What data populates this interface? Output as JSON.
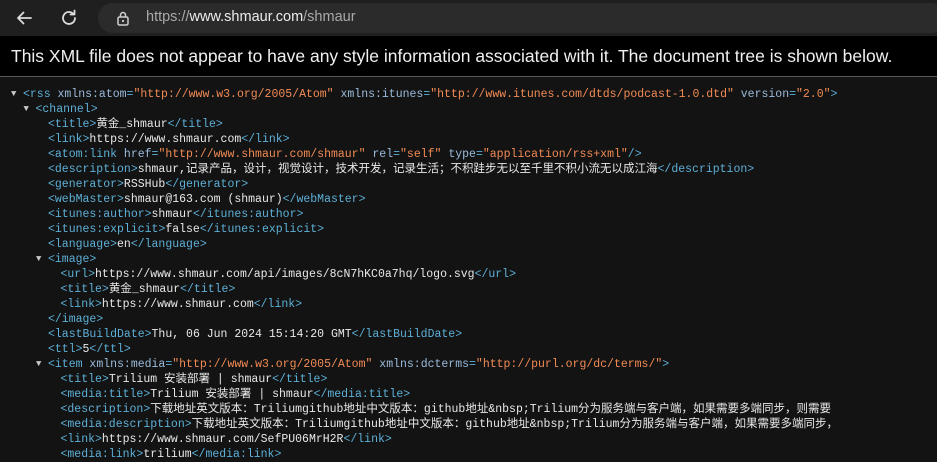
{
  "browser": {
    "url_prefix": "https://",
    "url_domain": "www.shmaur.com",
    "url_path": "/shmaur"
  },
  "notice": "This XML file does not appear to have any style information associated with it. The document tree is shown below.",
  "xml_lines": [
    {
      "indent": 0,
      "arrow": true,
      "tokens": [
        [
          "t",
          "<rss "
        ],
        [
          "an",
          "xmlns:atom"
        ],
        [
          "t",
          "="
        ],
        [
          "av",
          "\"http://www.w3.org/2005/Atom\""
        ],
        [
          "t",
          " "
        ],
        [
          "an",
          "xmlns:itunes"
        ],
        [
          "t",
          "="
        ],
        [
          "av",
          "\"http://www.itunes.com/dtds/podcast-1.0.dtd\""
        ],
        [
          "t",
          " "
        ],
        [
          "an",
          "version"
        ],
        [
          "t",
          "="
        ],
        [
          "av",
          "\"2.0\""
        ],
        [
          "t",
          ">"
        ]
      ]
    },
    {
      "indent": 1,
      "arrow": true,
      "tokens": [
        [
          "t",
          "<channel>"
        ]
      ]
    },
    {
      "indent": 2,
      "arrow": false,
      "tokens": [
        [
          "t",
          "<title>"
        ],
        [
          "tx",
          "黄金_shmaur"
        ],
        [
          "t",
          "</title>"
        ]
      ]
    },
    {
      "indent": 2,
      "arrow": false,
      "tokens": [
        [
          "t",
          "<link>"
        ],
        [
          "tx",
          "https://www.shmaur.com"
        ],
        [
          "t",
          "</link>"
        ]
      ]
    },
    {
      "indent": 2,
      "arrow": false,
      "tokens": [
        [
          "t",
          "<atom:link "
        ],
        [
          "an",
          "href"
        ],
        [
          "t",
          "="
        ],
        [
          "av",
          "\"http://www.shmaur.com/shmaur\""
        ],
        [
          "t",
          " "
        ],
        [
          "an",
          "rel"
        ],
        [
          "t",
          "="
        ],
        [
          "av",
          "\"self\""
        ],
        [
          "t",
          " "
        ],
        [
          "an",
          "type"
        ],
        [
          "t",
          "="
        ],
        [
          "av",
          "\"application/rss+xml\""
        ],
        [
          "t",
          "/>"
        ]
      ]
    },
    {
      "indent": 2,
      "arrow": false,
      "tokens": [
        [
          "t",
          "<description>"
        ],
        [
          "tx",
          "shmaur,记录产品，设计，视觉设计，技术开发，记录生活；不积跬步无以至千里不积小流无以成江海"
        ],
        [
          "t",
          "</description>"
        ]
      ]
    },
    {
      "indent": 2,
      "arrow": false,
      "tokens": [
        [
          "t",
          "<generator>"
        ],
        [
          "tx",
          "RSSHub"
        ],
        [
          "t",
          "</generator>"
        ]
      ]
    },
    {
      "indent": 2,
      "arrow": false,
      "tokens": [
        [
          "t",
          "<webMaster>"
        ],
        [
          "tx",
          "shmaur@163.com (shmaur)"
        ],
        [
          "t",
          "</webMaster>"
        ]
      ]
    },
    {
      "indent": 2,
      "arrow": false,
      "tokens": [
        [
          "t",
          "<itunes:author>"
        ],
        [
          "tx",
          "shmaur"
        ],
        [
          "t",
          "</itunes:author>"
        ]
      ]
    },
    {
      "indent": 2,
      "arrow": false,
      "tokens": [
        [
          "t",
          "<itunes:explicit>"
        ],
        [
          "tx",
          "false"
        ],
        [
          "t",
          "</itunes:explicit>"
        ]
      ]
    },
    {
      "indent": 2,
      "arrow": false,
      "tokens": [
        [
          "t",
          "<language>"
        ],
        [
          "tx",
          "en"
        ],
        [
          "t",
          "</language>"
        ]
      ]
    },
    {
      "indent": 2,
      "arrow": true,
      "tokens": [
        [
          "t",
          "<image>"
        ]
      ]
    },
    {
      "indent": 3,
      "arrow": false,
      "tokens": [
        [
          "t",
          "<url>"
        ],
        [
          "tx",
          "https://www.shmaur.com/api/images/8cN7hKC0a7hq/logo.svg"
        ],
        [
          "t",
          "</url>"
        ]
      ]
    },
    {
      "indent": 3,
      "arrow": false,
      "tokens": [
        [
          "t",
          "<title>"
        ],
        [
          "tx",
          "黄金_shmaur"
        ],
        [
          "t",
          "</title>"
        ]
      ]
    },
    {
      "indent": 3,
      "arrow": false,
      "tokens": [
        [
          "t",
          "<link>"
        ],
        [
          "tx",
          "https://www.shmaur.com"
        ],
        [
          "t",
          "</link>"
        ]
      ]
    },
    {
      "indent": 2,
      "arrow": false,
      "tokens": [
        [
          "t",
          "</image>"
        ]
      ]
    },
    {
      "indent": 2,
      "arrow": false,
      "tokens": [
        [
          "t",
          "<lastBuildDate>"
        ],
        [
          "tx",
          "Thu, 06 Jun 2024 15:14:20 GMT"
        ],
        [
          "t",
          "</lastBuildDate>"
        ]
      ]
    },
    {
      "indent": 2,
      "arrow": false,
      "tokens": [
        [
          "t",
          "<ttl>"
        ],
        [
          "tx",
          "5"
        ],
        [
          "t",
          "</ttl>"
        ]
      ]
    },
    {
      "indent": 2,
      "arrow": true,
      "tokens": [
        [
          "t",
          "<item "
        ],
        [
          "an",
          "xmlns:media"
        ],
        [
          "t",
          "="
        ],
        [
          "av",
          "\"http://www.w3.org/2005/Atom\""
        ],
        [
          "t",
          " "
        ],
        [
          "an",
          "xmlns:dcterms"
        ],
        [
          "t",
          "="
        ],
        [
          "av",
          "\"http://purl.org/dc/terms/\""
        ],
        [
          "t",
          ">"
        ]
      ]
    },
    {
      "indent": 3,
      "arrow": false,
      "tokens": [
        [
          "t",
          "<title>"
        ],
        [
          "tx",
          "Trilium 安装部署 | shmaur"
        ],
        [
          "t",
          "</title>"
        ]
      ]
    },
    {
      "indent": 3,
      "arrow": false,
      "tokens": [
        [
          "t",
          "<media:title>"
        ],
        [
          "tx",
          "Trilium 安装部署 | shmaur"
        ],
        [
          "t",
          "</media:title>"
        ]
      ]
    },
    {
      "indent": 3,
      "arrow": false,
      "tokens": [
        [
          "t",
          "<description>"
        ],
        [
          "tx",
          "下载地址英文版本：Triliumgithub地址中文版本：github地址&nbsp;Trilium分为服务端与客户端，如果需要多端同步，则需要"
        ]
      ]
    },
    {
      "indent": 3,
      "arrow": false,
      "tokens": [
        [
          "t",
          "<media:description>"
        ],
        [
          "tx",
          "下载地址英文版本：Triliumgithub地址中文版本：github地址&nbsp;Trilium分为服务端与客户端，如果需要多端同步，"
        ]
      ]
    },
    {
      "indent": 3,
      "arrow": false,
      "tokens": [
        [
          "t",
          "<link>"
        ],
        [
          "tx",
          "https://www.shmaur.com/SefPU06MrH2R"
        ],
        [
          "t",
          "</link>"
        ]
      ]
    },
    {
      "indent": 3,
      "arrow": false,
      "tokens": [
        [
          "t",
          "<media:link>"
        ],
        [
          "tx",
          "trilium"
        ],
        [
          "t",
          "</media:link>"
        ]
      ]
    }
  ]
}
